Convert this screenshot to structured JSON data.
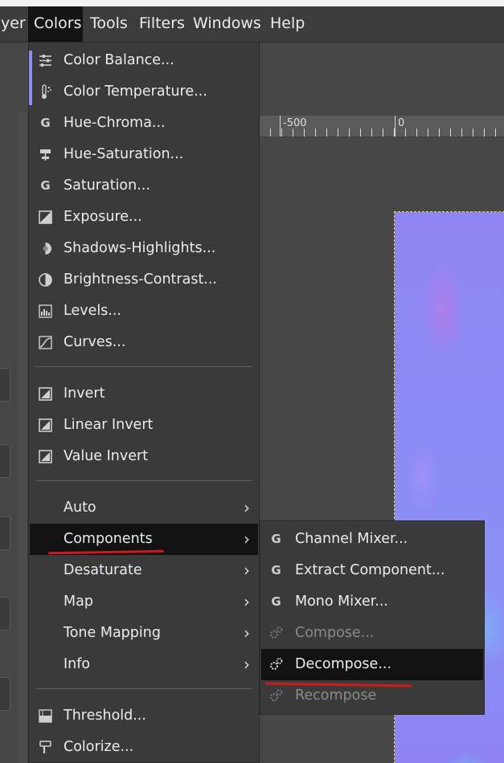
{
  "menubar": {
    "items": [
      "yer",
      "Colors",
      "Tools",
      "Filters",
      "Windows",
      "Help"
    ],
    "active": "Colors"
  },
  "ruler": {
    "labels": [
      "-500",
      "0"
    ]
  },
  "colors_menu": {
    "group1": [
      {
        "label": "Color Balance...",
        "icon": "sliders-icon"
      },
      {
        "label": "Color Temperature...",
        "icon": "thermometer-icon"
      },
      {
        "label": "Hue-Chroma...",
        "icon": "gegl-icon"
      },
      {
        "label": "Hue-Saturation...",
        "icon": "hue-saturation-icon"
      },
      {
        "label": "Saturation...",
        "icon": "gegl-icon"
      },
      {
        "label": "Exposure...",
        "icon": "exposure-icon"
      },
      {
        "label": "Shadows-Highlights...",
        "icon": "shadows-highlights-icon"
      },
      {
        "label": "Brightness-Contrast...",
        "icon": "brightness-contrast-icon"
      },
      {
        "label": "Levels...",
        "icon": "levels-icon"
      },
      {
        "label": "Curves...",
        "icon": "curves-icon"
      }
    ],
    "group2": [
      {
        "label": "Invert",
        "icon": "invert-icon"
      },
      {
        "label": "Linear Invert",
        "icon": "invert-icon"
      },
      {
        "label": "Value Invert",
        "icon": "invert-icon"
      }
    ],
    "group3": [
      {
        "label": "Auto",
        "has_submenu": true
      },
      {
        "label": "Components",
        "has_submenu": true,
        "highlighted": true
      },
      {
        "label": "Desaturate",
        "has_submenu": true
      },
      {
        "label": "Map",
        "has_submenu": true
      },
      {
        "label": "Tone Mapping",
        "has_submenu": true
      },
      {
        "label": "Info",
        "has_submenu": true
      }
    ],
    "group4": [
      {
        "label": "Threshold...",
        "icon": "threshold-icon"
      },
      {
        "label": "Colorize...",
        "icon": "colorize-icon"
      }
    ],
    "submenu_arrow": "›"
  },
  "components_submenu": {
    "items": [
      {
        "label": "Channel Mixer...",
        "icon": "gegl-icon",
        "enabled": true
      },
      {
        "label": "Extract Component...",
        "icon": "gegl-icon",
        "enabled": true
      },
      {
        "label": "Mono Mixer...",
        "icon": "gegl-icon",
        "enabled": true
      },
      {
        "label": "Compose...",
        "icon": "gears-icon",
        "enabled": false
      },
      {
        "label": "Decompose...",
        "icon": "gears-icon",
        "enabled": true,
        "highlighted": true
      },
      {
        "label": "Recompose",
        "icon": "gears-icon",
        "enabled": false
      }
    ]
  },
  "colors": {
    "menu_bg": "#3a3a3a",
    "highlight_bg": "#121212",
    "annotation_red": "#d21818",
    "canvas_blue": "#8c8af4"
  }
}
